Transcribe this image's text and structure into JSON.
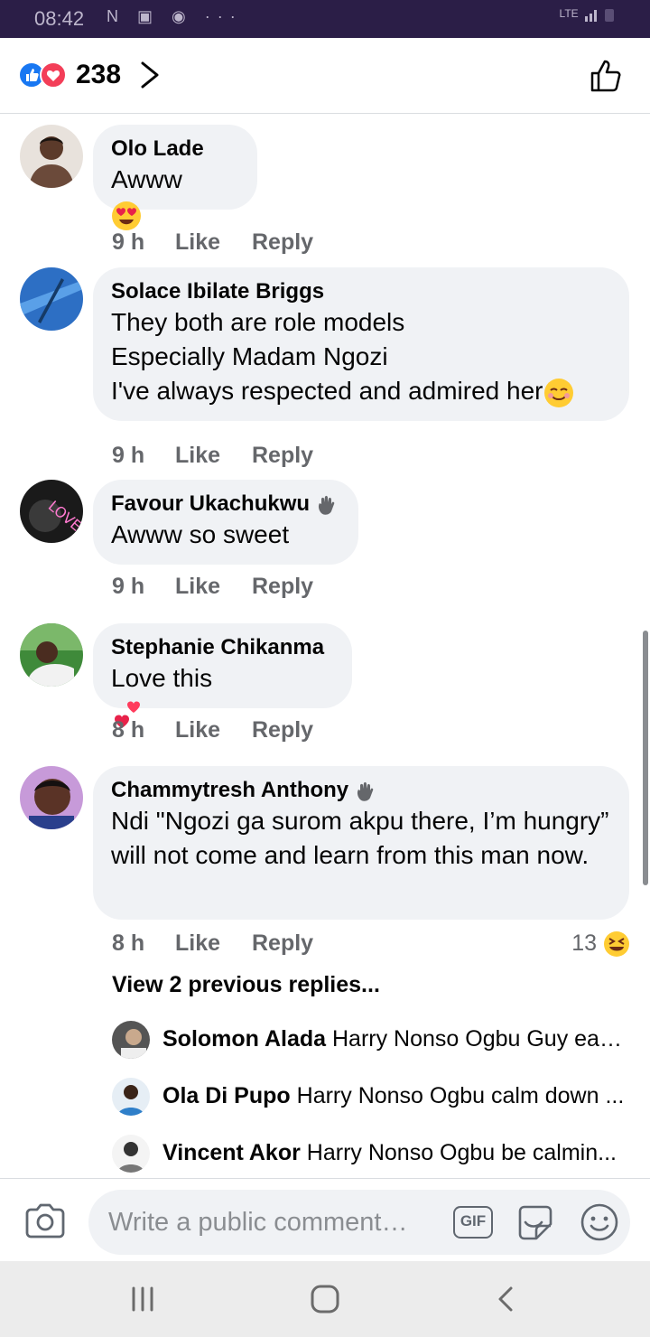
{
  "status_bar": {
    "time": "08:42",
    "network": "LTE"
  },
  "header": {
    "reaction_count": "238"
  },
  "comments": [
    {
      "author": "Olo Lade",
      "text": "Awww",
      "time": "9 h",
      "like": "Like",
      "reply": "Reply"
    },
    {
      "author": "Solace Ibilate Briggs",
      "text": "They both are role models\nEspecially Madam Ngozi\nI've always respected and admired her",
      "time": "9 h",
      "like": "Like",
      "reply": "Reply"
    },
    {
      "author": "Favour Ukachukwu",
      "text": "Awww so sweet",
      "time": "9 h",
      "like": "Like",
      "reply": "Reply"
    },
    {
      "author": "Stephanie Chikanma",
      "text": "Love this",
      "time": "8 h",
      "like": "Like",
      "reply": "Reply"
    },
    {
      "author": "Chammytresh Anthony",
      "text": "Ndi \"Ngozi ga surom akpu there, I’m hungry” will not come and learn from this man now.",
      "time": "8 h",
      "like": "Like",
      "reply": "Reply",
      "reaction_count": "13"
    }
  ],
  "replies": {
    "view_previous": "View 2 previous replies...",
    "items": [
      {
        "author": "Solomon Alada",
        "text": "Harry Nonso Ogbu Guy eas..."
      },
      {
        "author": "Ola Di Pupo",
        "text": "Harry Nonso Ogbu calm down ..."
      },
      {
        "author": "Vincent Akor",
        "text": "Harry Nonso Ogbu be calmin..."
      }
    ]
  },
  "composer": {
    "placeholder": "Write a public comment…",
    "gif_label": "GIF"
  },
  "colors": {
    "brand_blue": "#1877f2",
    "love_red": "#f33e58",
    "bubble_bg": "#f0f2f5",
    "meta_gray": "#65676b",
    "status_bar": "#2b1e47"
  },
  "icons": [
    "like-reaction-icon",
    "love-reaction-icon",
    "chevron-right-icon",
    "thumbs-up-icon",
    "heart-eyes-emoji-icon",
    "smiling-emoji-icon",
    "waving-hand-icon",
    "two-hearts-emoji-icon",
    "laughing-emoji-icon",
    "camera-icon",
    "gif-icon",
    "sticker-icon",
    "emoji-icon",
    "recents-icon",
    "home-icon",
    "back-icon"
  ]
}
